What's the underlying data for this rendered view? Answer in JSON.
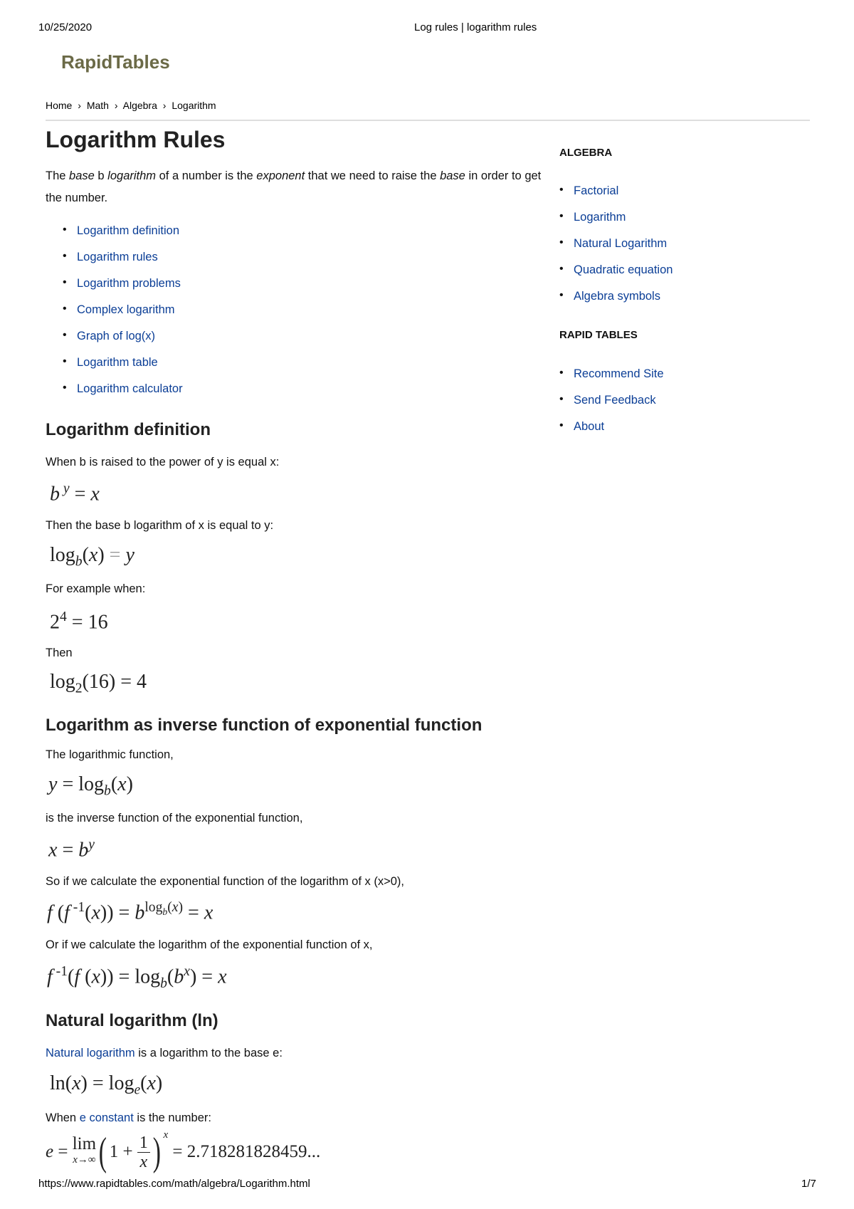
{
  "print_header": {
    "date": "10/25/2020",
    "title": "Log rules | logarithm rules"
  },
  "logo": "RapidTables",
  "breadcrumb": [
    "Home",
    "›",
    "Math",
    "›",
    "Algebra",
    "›",
    "Logarithm"
  ],
  "page_title": "Logarithm Rules",
  "intro": {
    "t1": "The ",
    "t2": "base",
    "t3": " b ",
    "t4": "logarithm",
    "t5": " of a number is the ",
    "t6": "exponent",
    "t7": " that we need to raise the ",
    "t8": "base",
    "t9": " in order to get the number."
  },
  "toc": [
    "Logarithm definition",
    "Logarithm rules",
    "Logarithm problems",
    "Complex logarithm",
    "Graph of log(x)",
    "Logarithm table",
    "Logarithm calculator"
  ],
  "sidebar": {
    "algebra_heading": "ALGEBRA",
    "algebra_links": [
      "Factorial",
      "Logarithm",
      "Natural Logarithm",
      "Quadratic equation",
      "Algebra symbols"
    ],
    "rapid_heading": "RAPID TABLES",
    "rapid_links": [
      "Recommend Site",
      "Send Feedback",
      "About"
    ]
  },
  "definition": {
    "heading": "Logarithm definition",
    "p1": "When b is raised to the power of y is equal x:",
    "p2": "Then the base b logarithm of x is equal to y:",
    "p3": "For example when:",
    "p4": "Then",
    "eq_example": "2",
    "eq_example_exp": "4",
    "eq_example_rhs": " = 16",
    "eq_log2": "log",
    "eq_log2_base": "2",
    "eq_log2_rhs": "(16) = 4"
  },
  "inverse": {
    "heading": "Logarithm as inverse function of exponential function",
    "p1": "The logarithmic function,",
    "p2": "is the inverse function of the exponential function,",
    "p3": "So if we calculate the exponential function of the logarithm of x (x>0),",
    "p4": "Or if we calculate the logarithm of the exponential function of x,"
  },
  "natural": {
    "heading": "Natural logarithm (ln)",
    "link1": "Natural logarithm",
    "p1_rest": " is a logarithm to the base e:",
    "p2_pre": "When ",
    "link2": "e constant",
    "p2_rest": " is the number:",
    "e_value": "= 2.718281828459..."
  },
  "footer": {
    "url": "https://www.rapidtables.com/math/algebra/Logarithm.html",
    "page": "1/7"
  }
}
